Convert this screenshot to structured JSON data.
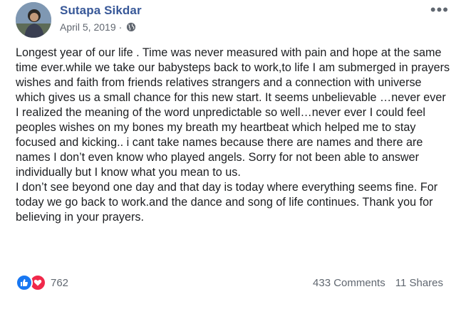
{
  "post": {
    "author": "Sutapa Sikdar",
    "date": "April 5, 2019",
    "separator": "·",
    "body": "Longest year of our life . Time was never measured with pain and hope at the same time ever.while we take our babysteps back to work,to life I am submerged in prayers wishes and faith from friends relatives strangers and a connection with universe which gives us a small chance for this new start. It seems unbelievable …never ever I realized the meaning of the word unpredictable so well…never ever I could feel peoples wishes on my bones my breath my heartbeat which helped me to stay focused and kicking.. i cant take names because there are names and there are names I don’t even know who played angels. Sorry for not been able to answer individually but I know what you mean to us.\nI don’t see beyond one day and that day is today where everything seems fine. For today we go back to work.and the dance and song of life continues. Thank you for believing in your prayers."
  },
  "footer": {
    "reaction_count": "762",
    "comments": "433 Comments",
    "shares": "11 Shares"
  },
  "icons": {
    "more": "more-options-icon",
    "privacy": "globe-icon",
    "like": "like-icon",
    "love": "love-icon"
  },
  "colors": {
    "author": "#385898",
    "like": "#1877f2",
    "love": "#f0284a",
    "muted": "#616770"
  }
}
